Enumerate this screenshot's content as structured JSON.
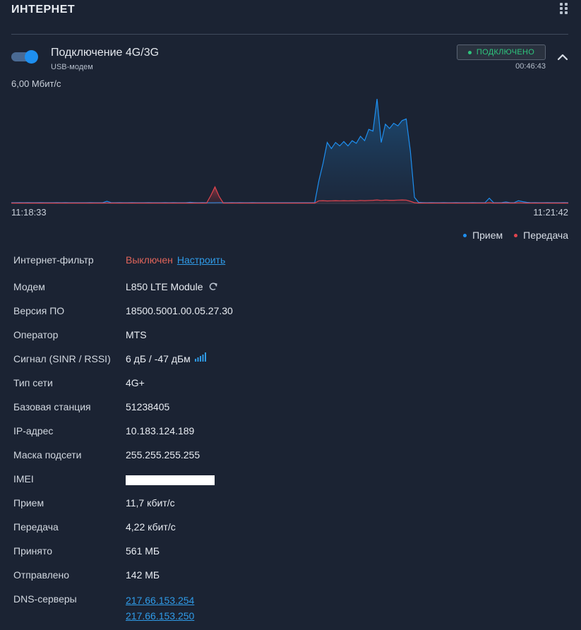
{
  "widget": {
    "title": "ИНТЕРНЕТ"
  },
  "connection": {
    "name": "Подключение 4G/3G",
    "type": "USB-модем",
    "status": "ПОДКЛЮЧЕНО",
    "uptime": "00:46:43",
    "enabled": true
  },
  "colors": {
    "accent": "#1e8ff0",
    "rx": "#1e8ff0",
    "tx": "#e0444e",
    "status_ok": "#2ec77e",
    "filter_off": "#e0645a",
    "link": "#2f9be8"
  },
  "chart_data": {
    "type": "area",
    "ymax_label": "6,00 Мбит/с",
    "ylim": [
      0,
      6.0
    ],
    "unit": "Мбит/с",
    "x_start_label": "11:18:33",
    "x_end_label": "11:21:42",
    "legend_position": "bottom-right",
    "grid": false,
    "series": [
      {
        "name": "Прием",
        "color": "#1e8ff0",
        "values": [
          0.04,
          0.04,
          0.05,
          0.04,
          0.05,
          0.04,
          0.04,
          0.05,
          0.04,
          0.04,
          0.04,
          0.05,
          0.04,
          0.05,
          0.04,
          0.04,
          0.04,
          0.04,
          0.04,
          0.05,
          0.04,
          0.04,
          0.04,
          0.12,
          0.05,
          0.04,
          0.05,
          0.04,
          0.04,
          0.05,
          0.04,
          0.04,
          0.04,
          0.05,
          0.04,
          0.04,
          0.04,
          0.05,
          0.04,
          0.05,
          0.04,
          0.04,
          0.04,
          0.06,
          0.05,
          0.04,
          0.05,
          0.04,
          0.04,
          0.04,
          0.05,
          0.04,
          0.04,
          0.05,
          0.04,
          0.05,
          0.04,
          0.04,
          0.05,
          0.04,
          0.04,
          0.04,
          0.04,
          0.04,
          0.04,
          0.04,
          0.04,
          0.04,
          0.04,
          0.04,
          0.04,
          0.04,
          0.04,
          0.04,
          1.3,
          2.3,
          3.5,
          3.15,
          3.5,
          3.3,
          3.55,
          3.3,
          3.6,
          3.45,
          3.85,
          3.6,
          4.25,
          4.15,
          6.0,
          3.5,
          4.55,
          4.3,
          4.6,
          4.45,
          4.75,
          4.85,
          3.0,
          0.35,
          0.06,
          0.05,
          0.04,
          0.05,
          0.04,
          0.04,
          0.05,
          0.04,
          0.04,
          0.05,
          0.04,
          0.04,
          0.04,
          0.05,
          0.04,
          0.04,
          0.05,
          0.3,
          0.05,
          0.04,
          0.05,
          0.08,
          0.04,
          0.05,
          0.15,
          0.1,
          0.06,
          0.04,
          0.05,
          0.04,
          0.04,
          0.05,
          0.04,
          0.04,
          0.04,
          0.05,
          0.04
        ]
      },
      {
        "name": "Передача",
        "color": "#e0444e",
        "values": [
          0.02,
          0.02,
          0.02,
          0.02,
          0.02,
          0.02,
          0.02,
          0.02,
          0.02,
          0.02,
          0.02,
          0.02,
          0.02,
          0.02,
          0.02,
          0.02,
          0.02,
          0.02,
          0.02,
          0.02,
          0.02,
          0.02,
          0.02,
          0.03,
          0.02,
          0.02,
          0.02,
          0.02,
          0.02,
          0.02,
          0.02,
          0.02,
          0.02,
          0.02,
          0.02,
          0.02,
          0.02,
          0.02,
          0.02,
          0.02,
          0.02,
          0.02,
          0.02,
          0.02,
          0.02,
          0.02,
          0.02,
          0.02,
          0.45,
          0.95,
          0.4,
          0.02,
          0.02,
          0.02,
          0.02,
          0.02,
          0.02,
          0.02,
          0.02,
          0.02,
          0.02,
          0.02,
          0.02,
          0.02,
          0.02,
          0.02,
          0.02,
          0.02,
          0.02,
          0.02,
          0.02,
          0.02,
          0.02,
          0.02,
          0.15,
          0.16,
          0.14,
          0.15,
          0.16,
          0.15,
          0.16,
          0.15,
          0.16,
          0.15,
          0.17,
          0.16,
          0.17,
          0.18,
          0.2,
          0.17,
          0.19,
          0.18,
          0.18,
          0.19,
          0.2,
          0.19,
          0.12,
          0.04,
          0.02,
          0.02,
          0.02,
          0.02,
          0.02,
          0.02,
          0.02,
          0.02,
          0.02,
          0.02,
          0.02,
          0.02,
          0.02,
          0.02,
          0.02,
          0.02,
          0.02,
          0.04,
          0.02,
          0.02,
          0.02,
          0.03,
          0.02,
          0.02,
          0.04,
          0.03,
          0.02,
          0.02,
          0.02,
          0.02,
          0.02,
          0.02,
          0.02,
          0.02,
          0.02,
          0.02,
          0.02
        ]
      }
    ]
  },
  "legend": {
    "rx_label": "Прием",
    "tx_label": "Передача"
  },
  "info": {
    "filter_label": "Интернет-фильтр",
    "filter_value": "Выключен",
    "filter_link": "Настроить",
    "modem_label": "Модем",
    "modem_value": "L850 LTE Module",
    "fw_label": "Версия ПО",
    "fw_value": "18500.5001.00.05.27.30",
    "operator_label": "Оператор",
    "operator_value": "MTS",
    "signal_label": "Сигнал (SINR / RSSI)",
    "signal_value": "6 дБ / -47 дБм",
    "signal_bars": 5,
    "nettype_label": "Тип сети",
    "nettype_value": "4G+",
    "bs_label": "Базовая станция",
    "bs_value": "51238405",
    "ip_label": "IP-адрес",
    "ip_value": "10.183.124.189",
    "mask_label": "Маска подсети",
    "mask_value": "255.255.255.255",
    "imei_label": "IMEI",
    "rx_label": "Прием",
    "rx_value": "11,7 кбит/с",
    "tx_label": "Передача",
    "tx_value": "4,22 кбит/с",
    "received_label": "Принято",
    "received_value": "561 МБ",
    "sent_label": "Отправлено",
    "sent_value": "142 МБ",
    "dns_label": "DNS-серверы",
    "dns": [
      "217.66.153.254",
      "217.66.153.250"
    ]
  }
}
